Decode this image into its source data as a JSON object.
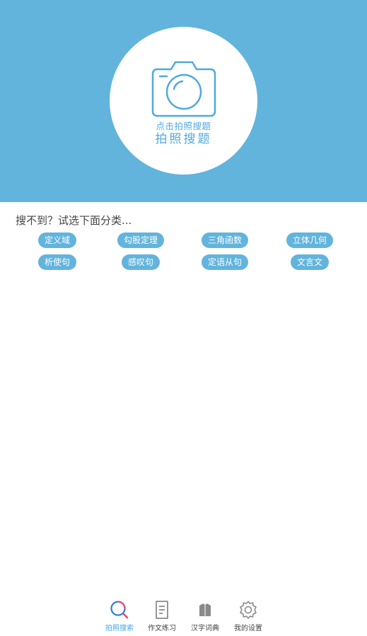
{
  "camera": {
    "icon": "camera-icon",
    "hint": "点击拍照搜题",
    "title": "拍照搜题"
  },
  "prompt": "搜不到？试选下面分类...",
  "categories": [
    {
      "label": "定义域"
    },
    {
      "label": "勾股定理"
    },
    {
      "label": "三角函数"
    },
    {
      "label": "立体几何"
    },
    {
      "label": "析使句"
    },
    {
      "label": "感叹句"
    },
    {
      "label": "定语从句"
    },
    {
      "label": "文言文"
    }
  ],
  "tabs": [
    {
      "label": "拍照搜索",
      "icon": "magnifier-icon",
      "active": true
    },
    {
      "label": "作文练习",
      "icon": "document-icon",
      "active": false
    },
    {
      "label": "汉字词典",
      "icon": "book-icon",
      "active": false
    },
    {
      "label": "我的设置",
      "icon": "gear-icon",
      "active": false
    }
  ],
  "colors": {
    "accent": "#62b4dc",
    "active_tab": "#4aa6e0",
    "text": "#444444"
  }
}
